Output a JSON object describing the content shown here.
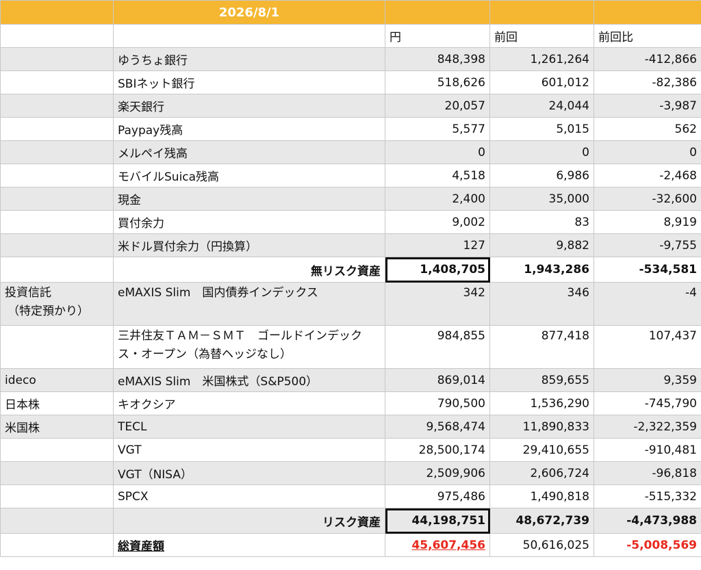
{
  "header": {
    "date": "2026/8/1"
  },
  "columns": {
    "yen": "円",
    "prev": "前回",
    "diff": "前回比"
  },
  "rows": [
    {
      "cat": "",
      "name": "ゆうちょ銀行",
      "yen": "848,398",
      "prev": "1,261,264",
      "diff": "-412,866"
    },
    {
      "cat": "",
      "name": "SBIネット銀行",
      "yen": "518,626",
      "prev": "601,012",
      "diff": "-82,386"
    },
    {
      "cat": "",
      "name": "楽天銀行",
      "yen": "20,057",
      "prev": "24,044",
      "diff": "-3,987"
    },
    {
      "cat": "",
      "name": "Paypay残高",
      "yen": "5,577",
      "prev": "5,015",
      "diff": "562"
    },
    {
      "cat": "",
      "name": "メルペイ残高",
      "yen": "0",
      "prev": "0",
      "diff": "0"
    },
    {
      "cat": "",
      "name": "モバイルSuica残高",
      "yen": "4,518",
      "prev": "6,986",
      "diff": "-2,468"
    },
    {
      "cat": "",
      "name": "現金",
      "yen": "2,400",
      "prev": "35,000",
      "diff": "-32,600"
    },
    {
      "cat": "",
      "name": "買付余力",
      "yen": "9,002",
      "prev": "83",
      "diff": "8,919"
    },
    {
      "cat": "",
      "name": "米ドル買付余力（円換算）",
      "yen": "127",
      "prev": "9,882",
      "diff": "-9,755"
    }
  ],
  "riskfree_total": {
    "label": "無リスク資産",
    "yen": "1,408,705",
    "prev": "1,943,286",
    "diff": "-534,581"
  },
  "fund_category": {
    "line1": "投資信託",
    "line2": "（特定預かり）"
  },
  "fund_rows": [
    {
      "name": "eMAXIS Slim　国内債券インデックス",
      "yen": "342",
      "prev": "346",
      "diff": "-4"
    },
    {
      "name": "三井住友ＴＡＭ－ＳＭＴ　ゴールドインデックス・オープン（為替ヘッジなし）",
      "yen": "984,855",
      "prev": "877,418",
      "diff": "107,437"
    }
  ],
  "risk_rows": [
    {
      "cat": "ideco",
      "name": "eMAXIS Slim　米国株式（S&P500）",
      "yen": "869,014",
      "prev": "859,655",
      "diff": "9,359"
    },
    {
      "cat": "日本株",
      "name": "キオクシア",
      "yen": "790,500",
      "prev": "1,536,290",
      "diff": "-745,790"
    },
    {
      "cat": "米国株",
      "name": "TECL",
      "yen": "9,568,474",
      "prev": "11,890,833",
      "diff": "-2,322,359"
    },
    {
      "cat": "",
      "name": "VGT",
      "yen": "28,500,174",
      "prev": "29,410,655",
      "diff": "-910,481"
    },
    {
      "cat": "",
      "name": "VGT（NISA）",
      "yen": "2,509,906",
      "prev": "2,606,724",
      "diff": "-96,818"
    },
    {
      "cat": "",
      "name": "SPCX",
      "yen": "975,486",
      "prev": "1,490,818",
      "diff": "-515,332"
    }
  ],
  "risk_total": {
    "label": "リスク資産",
    "yen": "44,198,751",
    "prev": "48,672,739",
    "diff": "-4,473,988"
  },
  "grand_total": {
    "label": "総資産額",
    "yen": "45,607,456",
    "prev": "50,616,025",
    "diff": "-5,008,569"
  },
  "colors": {
    "header": "#f5b731",
    "stripe": "#e8e8e8",
    "negative_total": "#e8291e"
  }
}
